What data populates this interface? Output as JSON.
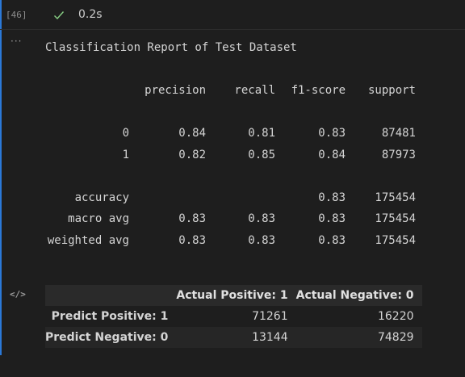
{
  "cell": {
    "execution_count": "[46]",
    "status_icon": "check-icon",
    "exec_time": "0.2s",
    "more_icon": "ellipsis-icon",
    "output_icon": "code-icon"
  },
  "report": {
    "title": "Classification Report of Test Dataset",
    "headers": [
      "precision",
      "recall",
      "f1-score",
      "support"
    ],
    "rows": [
      {
        "label": "0",
        "precision": "0.84",
        "recall": "0.81",
        "f1": "0.83",
        "support": "87481"
      },
      {
        "label": "1",
        "precision": "0.82",
        "recall": "0.85",
        "f1": "0.84",
        "support": "87973"
      }
    ],
    "summary": [
      {
        "label": "accuracy",
        "precision": "",
        "recall": "",
        "f1": "0.83",
        "support": "175454"
      },
      {
        "label": "macro avg",
        "precision": "0.83",
        "recall": "0.83",
        "f1": "0.83",
        "support": "175454"
      },
      {
        "label": "weighted avg",
        "precision": "0.83",
        "recall": "0.83",
        "f1": "0.83",
        "support": "175454"
      }
    ]
  },
  "confusion_matrix": {
    "columns": [
      "",
      "Actual Positive: 1",
      "Actual Negative: 0"
    ],
    "rows": [
      [
        "Predict Positive: 1",
        "71261",
        "16220"
      ],
      [
        "Predict Negative: 0",
        "13144",
        "74829"
      ]
    ]
  },
  "colors": {
    "accent": "#2b79d8",
    "success": "#89d185"
  }
}
